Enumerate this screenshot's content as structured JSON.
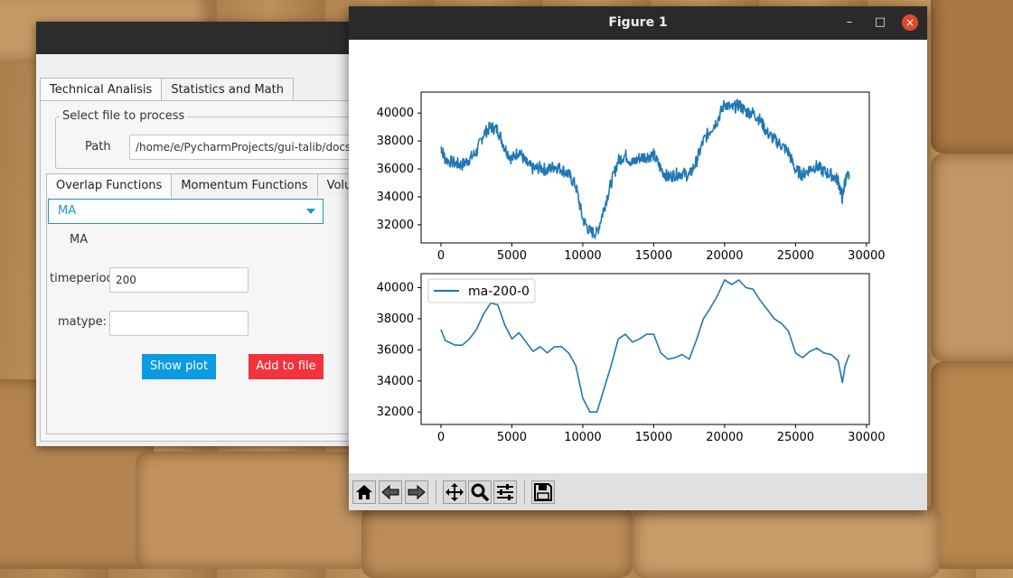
{
  "app": {
    "tabs": [
      "Technical Analisis",
      "Statistics and Math"
    ],
    "file_group_legend": "Select file to process",
    "path_label": "Path",
    "path_value": "/home/e/PycharmProjects/gui-talib/docs/",
    "function_tabs": [
      "Overlap Functions",
      "Momentum Functions",
      "Volume"
    ],
    "function_selected": "MA",
    "function_name": "MA",
    "timeperiod_label": "timeperiod:",
    "timeperiod_value": "200",
    "matype_label": "matype:",
    "matype_value": "",
    "show_plot_label": "Show plot",
    "add_to_file_label": "Add to file",
    "colors": {
      "accent": "#1f98c6",
      "show_plot": "#0a9be0",
      "add_to_file": "#f2323c"
    }
  },
  "figure": {
    "window_title": "Figure 1",
    "window_buttons": {
      "minimize": "–",
      "maximize": "□",
      "close": "×"
    },
    "toolbar_icons": [
      "home-icon",
      "back-icon",
      "forward-icon",
      "pan-icon",
      "zoom-icon",
      "configure-subplots-icon",
      "save-icon"
    ],
    "line_color": "#1f77b4"
  },
  "chart_data": [
    {
      "type": "line",
      "title": "",
      "xlabel": "",
      "ylabel": "",
      "xlim": [
        -1400,
        30200
      ],
      "ylim": [
        30700,
        41500
      ],
      "xticks": [
        "0",
        "5000",
        "10000",
        "15000",
        "20000",
        "25000",
        "30000"
      ],
      "yticks": [
        "32000",
        "34000",
        "36000",
        "38000",
        "40000"
      ],
      "legend": null,
      "series": [
        {
          "noisy": true,
          "x": [
            0,
            300,
            1000,
            1500,
            2000,
            2500,
            3000,
            3500,
            4000,
            4500,
            5000,
            5500,
            6000,
            6500,
            7000,
            7500,
            8000,
            8500,
            9000,
            9500,
            10000,
            10500,
            11000,
            11500,
            12000,
            12500,
            13000,
            13500,
            14000,
            14500,
            15000,
            15500,
            16000,
            16500,
            17000,
            17500,
            18000,
            18500,
            19000,
            19500,
            20000,
            20500,
            21000,
            21500,
            22000,
            22500,
            23000,
            23500,
            24000,
            24500,
            25000,
            25500,
            26000,
            26500,
            27000,
            27500,
            28000,
            28300,
            28500,
            28800
          ],
          "y": [
            37600,
            36700,
            36400,
            36300,
            36700,
            37200,
            38500,
            39000,
            38800,
            37500,
            36700,
            37300,
            36400,
            36000,
            36100,
            35900,
            36200,
            36000,
            35600,
            34800,
            32400,
            31500,
            31400,
            33200,
            35000,
            36600,
            37000,
            36400,
            36800,
            36900,
            37000,
            36000,
            35400,
            35600,
            35700,
            35500,
            36500,
            38000,
            38800,
            39500,
            40700,
            40300,
            40600,
            40100,
            40000,
            39500,
            38600,
            38100,
            37700,
            37200,
            35900,
            35600,
            36000,
            36200,
            35800,
            35600,
            35200,
            33900,
            35200,
            35600
          ]
        }
      ]
    },
    {
      "type": "line",
      "title": "",
      "xlabel": "",
      "ylabel": "",
      "xlim": [
        -1400,
        30200
      ],
      "ylim": [
        31200,
        40900
      ],
      "xticks": [
        "0",
        "5000",
        "10000",
        "15000",
        "20000",
        "25000",
        "30000"
      ],
      "yticks": [
        "32000",
        "34000",
        "36000",
        "38000",
        "40000"
      ],
      "legend": "top-left",
      "series": [
        {
          "name": "ma-200-0",
          "noisy": false,
          "x": [
            0,
            300,
            1000,
            1500,
            2000,
            2500,
            3000,
            3500,
            4000,
            4500,
            5000,
            5500,
            6000,
            6500,
            7000,
            7500,
            8000,
            8500,
            9000,
            9500,
            10000,
            10500,
            11000,
            11500,
            12000,
            12500,
            13000,
            13500,
            14000,
            14500,
            15000,
            15500,
            16000,
            16500,
            17000,
            17500,
            18000,
            18500,
            19000,
            19500,
            20000,
            20500,
            21000,
            21500,
            22000,
            22500,
            23000,
            23500,
            24000,
            24500,
            25000,
            25500,
            26000,
            26500,
            27000,
            27500,
            28000,
            28300,
            28500,
            28800
          ],
          "y": [
            37300,
            36600,
            36300,
            36300,
            36700,
            37300,
            38300,
            39000,
            38900,
            37600,
            36700,
            37100,
            36500,
            35900,
            36200,
            35800,
            36200,
            36200,
            35800,
            35000,
            32900,
            32000,
            32000,
            33500,
            35000,
            36700,
            37000,
            36500,
            36700,
            37000,
            37000,
            35800,
            35400,
            35500,
            35700,
            35400,
            36600,
            38000,
            38700,
            39500,
            40500,
            40200,
            40500,
            40000,
            39900,
            39200,
            38600,
            38000,
            37700,
            37200,
            35800,
            35500,
            35900,
            36100,
            35800,
            35700,
            35300,
            33900,
            35000,
            35700
          ]
        }
      ]
    }
  ]
}
